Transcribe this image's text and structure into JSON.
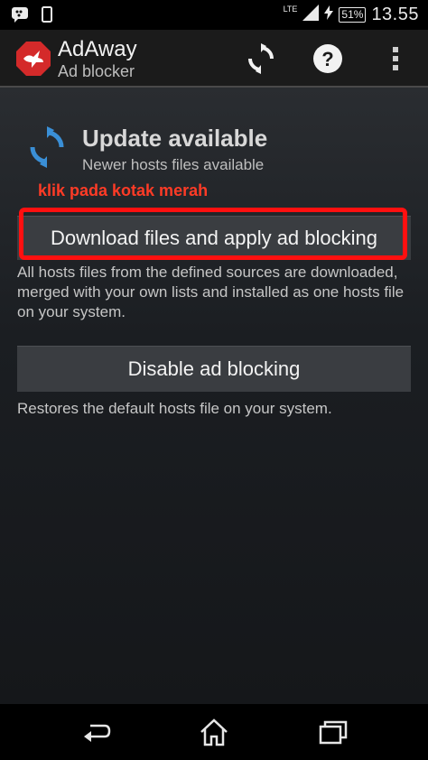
{
  "status_bar": {
    "time": "13.55",
    "battery": "51%",
    "network": "LTE",
    "icons": [
      "bbm-icon",
      "phone-icon",
      "signal-icon",
      "charging-icon",
      "battery-icon"
    ]
  },
  "action_bar": {
    "title": "AdAway",
    "subtitle": "Ad blocker",
    "icons": [
      "adaway-logo-icon",
      "refresh-icon",
      "help-icon",
      "overflow-menu-icon"
    ]
  },
  "status": {
    "title": "Update available",
    "subtitle": "Newer hosts files available",
    "icon": "sync-icon"
  },
  "annotation": "klik pada kotak merah",
  "download": {
    "label": "Download files and apply ad blocking",
    "description": "All hosts files from the defined sources are downloaded, merged with your own lists and installed as one hosts file on your system."
  },
  "disable": {
    "label": "Disable ad blocking",
    "description": "Restores the default hosts file on your system."
  },
  "nav_bar": {
    "icons": [
      "back-icon",
      "home-icon",
      "recent-apps-icon"
    ]
  },
  "colors": {
    "annotation_red": "#ff3b26",
    "highlight_frame": "#ff1010",
    "sync_blue": "#3a8fd6",
    "logo_red": "#d42a2a"
  }
}
